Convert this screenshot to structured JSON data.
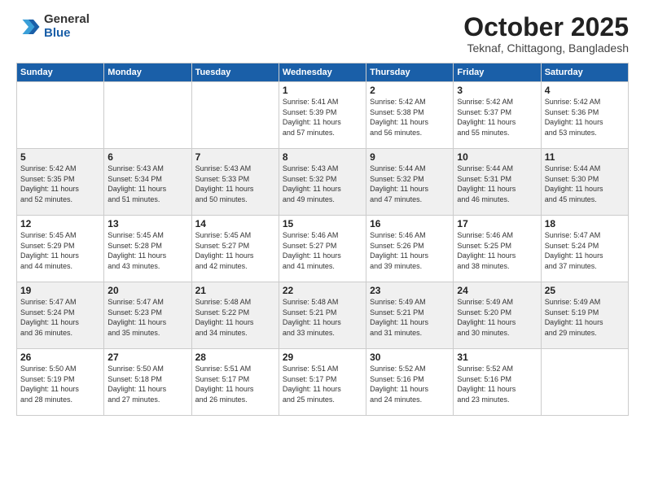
{
  "header": {
    "logo_general": "General",
    "logo_blue": "Blue",
    "month_title": "October 2025",
    "location": "Teknaf, Chittagong, Bangladesh"
  },
  "days_of_week": [
    "Sunday",
    "Monday",
    "Tuesday",
    "Wednesday",
    "Thursday",
    "Friday",
    "Saturday"
  ],
  "weeks": [
    {
      "alt": false,
      "days": [
        {
          "num": "",
          "info": ""
        },
        {
          "num": "",
          "info": ""
        },
        {
          "num": "",
          "info": ""
        },
        {
          "num": "1",
          "info": "Sunrise: 5:41 AM\nSunset: 5:39 PM\nDaylight: 11 hours\nand 57 minutes."
        },
        {
          "num": "2",
          "info": "Sunrise: 5:42 AM\nSunset: 5:38 PM\nDaylight: 11 hours\nand 56 minutes."
        },
        {
          "num": "3",
          "info": "Sunrise: 5:42 AM\nSunset: 5:37 PM\nDaylight: 11 hours\nand 55 minutes."
        },
        {
          "num": "4",
          "info": "Sunrise: 5:42 AM\nSunset: 5:36 PM\nDaylight: 11 hours\nand 53 minutes."
        }
      ]
    },
    {
      "alt": true,
      "days": [
        {
          "num": "5",
          "info": "Sunrise: 5:42 AM\nSunset: 5:35 PM\nDaylight: 11 hours\nand 52 minutes."
        },
        {
          "num": "6",
          "info": "Sunrise: 5:43 AM\nSunset: 5:34 PM\nDaylight: 11 hours\nand 51 minutes."
        },
        {
          "num": "7",
          "info": "Sunrise: 5:43 AM\nSunset: 5:33 PM\nDaylight: 11 hours\nand 50 minutes."
        },
        {
          "num": "8",
          "info": "Sunrise: 5:43 AM\nSunset: 5:32 PM\nDaylight: 11 hours\nand 49 minutes."
        },
        {
          "num": "9",
          "info": "Sunrise: 5:44 AM\nSunset: 5:32 PM\nDaylight: 11 hours\nand 47 minutes."
        },
        {
          "num": "10",
          "info": "Sunrise: 5:44 AM\nSunset: 5:31 PM\nDaylight: 11 hours\nand 46 minutes."
        },
        {
          "num": "11",
          "info": "Sunrise: 5:44 AM\nSunset: 5:30 PM\nDaylight: 11 hours\nand 45 minutes."
        }
      ]
    },
    {
      "alt": false,
      "days": [
        {
          "num": "12",
          "info": "Sunrise: 5:45 AM\nSunset: 5:29 PM\nDaylight: 11 hours\nand 44 minutes."
        },
        {
          "num": "13",
          "info": "Sunrise: 5:45 AM\nSunset: 5:28 PM\nDaylight: 11 hours\nand 43 minutes."
        },
        {
          "num": "14",
          "info": "Sunrise: 5:45 AM\nSunset: 5:27 PM\nDaylight: 11 hours\nand 42 minutes."
        },
        {
          "num": "15",
          "info": "Sunrise: 5:46 AM\nSunset: 5:27 PM\nDaylight: 11 hours\nand 41 minutes."
        },
        {
          "num": "16",
          "info": "Sunrise: 5:46 AM\nSunset: 5:26 PM\nDaylight: 11 hours\nand 39 minutes."
        },
        {
          "num": "17",
          "info": "Sunrise: 5:46 AM\nSunset: 5:25 PM\nDaylight: 11 hours\nand 38 minutes."
        },
        {
          "num": "18",
          "info": "Sunrise: 5:47 AM\nSunset: 5:24 PM\nDaylight: 11 hours\nand 37 minutes."
        }
      ]
    },
    {
      "alt": true,
      "days": [
        {
          "num": "19",
          "info": "Sunrise: 5:47 AM\nSunset: 5:24 PM\nDaylight: 11 hours\nand 36 minutes."
        },
        {
          "num": "20",
          "info": "Sunrise: 5:47 AM\nSunset: 5:23 PM\nDaylight: 11 hours\nand 35 minutes."
        },
        {
          "num": "21",
          "info": "Sunrise: 5:48 AM\nSunset: 5:22 PM\nDaylight: 11 hours\nand 34 minutes."
        },
        {
          "num": "22",
          "info": "Sunrise: 5:48 AM\nSunset: 5:21 PM\nDaylight: 11 hours\nand 33 minutes."
        },
        {
          "num": "23",
          "info": "Sunrise: 5:49 AM\nSunset: 5:21 PM\nDaylight: 11 hours\nand 31 minutes."
        },
        {
          "num": "24",
          "info": "Sunrise: 5:49 AM\nSunset: 5:20 PM\nDaylight: 11 hours\nand 30 minutes."
        },
        {
          "num": "25",
          "info": "Sunrise: 5:49 AM\nSunset: 5:19 PM\nDaylight: 11 hours\nand 29 minutes."
        }
      ]
    },
    {
      "alt": false,
      "days": [
        {
          "num": "26",
          "info": "Sunrise: 5:50 AM\nSunset: 5:19 PM\nDaylight: 11 hours\nand 28 minutes."
        },
        {
          "num": "27",
          "info": "Sunrise: 5:50 AM\nSunset: 5:18 PM\nDaylight: 11 hours\nand 27 minutes."
        },
        {
          "num": "28",
          "info": "Sunrise: 5:51 AM\nSunset: 5:17 PM\nDaylight: 11 hours\nand 26 minutes."
        },
        {
          "num": "29",
          "info": "Sunrise: 5:51 AM\nSunset: 5:17 PM\nDaylight: 11 hours\nand 25 minutes."
        },
        {
          "num": "30",
          "info": "Sunrise: 5:52 AM\nSunset: 5:16 PM\nDaylight: 11 hours\nand 24 minutes."
        },
        {
          "num": "31",
          "info": "Sunrise: 5:52 AM\nSunset: 5:16 PM\nDaylight: 11 hours\nand 23 minutes."
        },
        {
          "num": "",
          "info": ""
        }
      ]
    }
  ]
}
